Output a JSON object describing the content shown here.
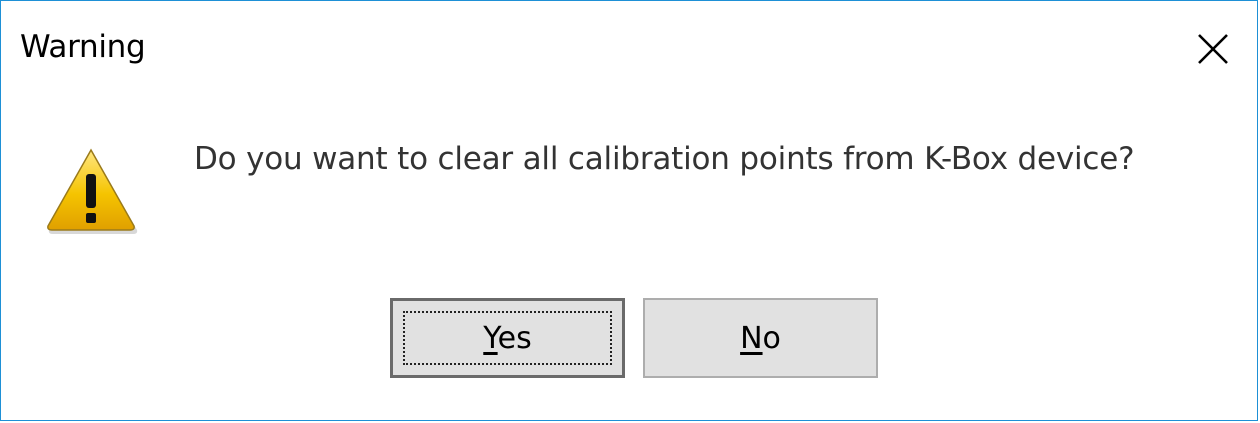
{
  "dialog": {
    "title": "Warning",
    "close_icon": "close-icon",
    "message_icon": "warning-icon",
    "message": "Do you want to clear all calibration points from K-Box device?",
    "buttons": {
      "yes": {
        "mnemonic": "Y",
        "rest": "es"
      },
      "no": {
        "mnemonic": "N",
        "rest": "o"
      }
    },
    "colors": {
      "border": "#1e90d6",
      "button_face": "#e1e1e1",
      "warning_yellow": "#f5c400"
    }
  }
}
